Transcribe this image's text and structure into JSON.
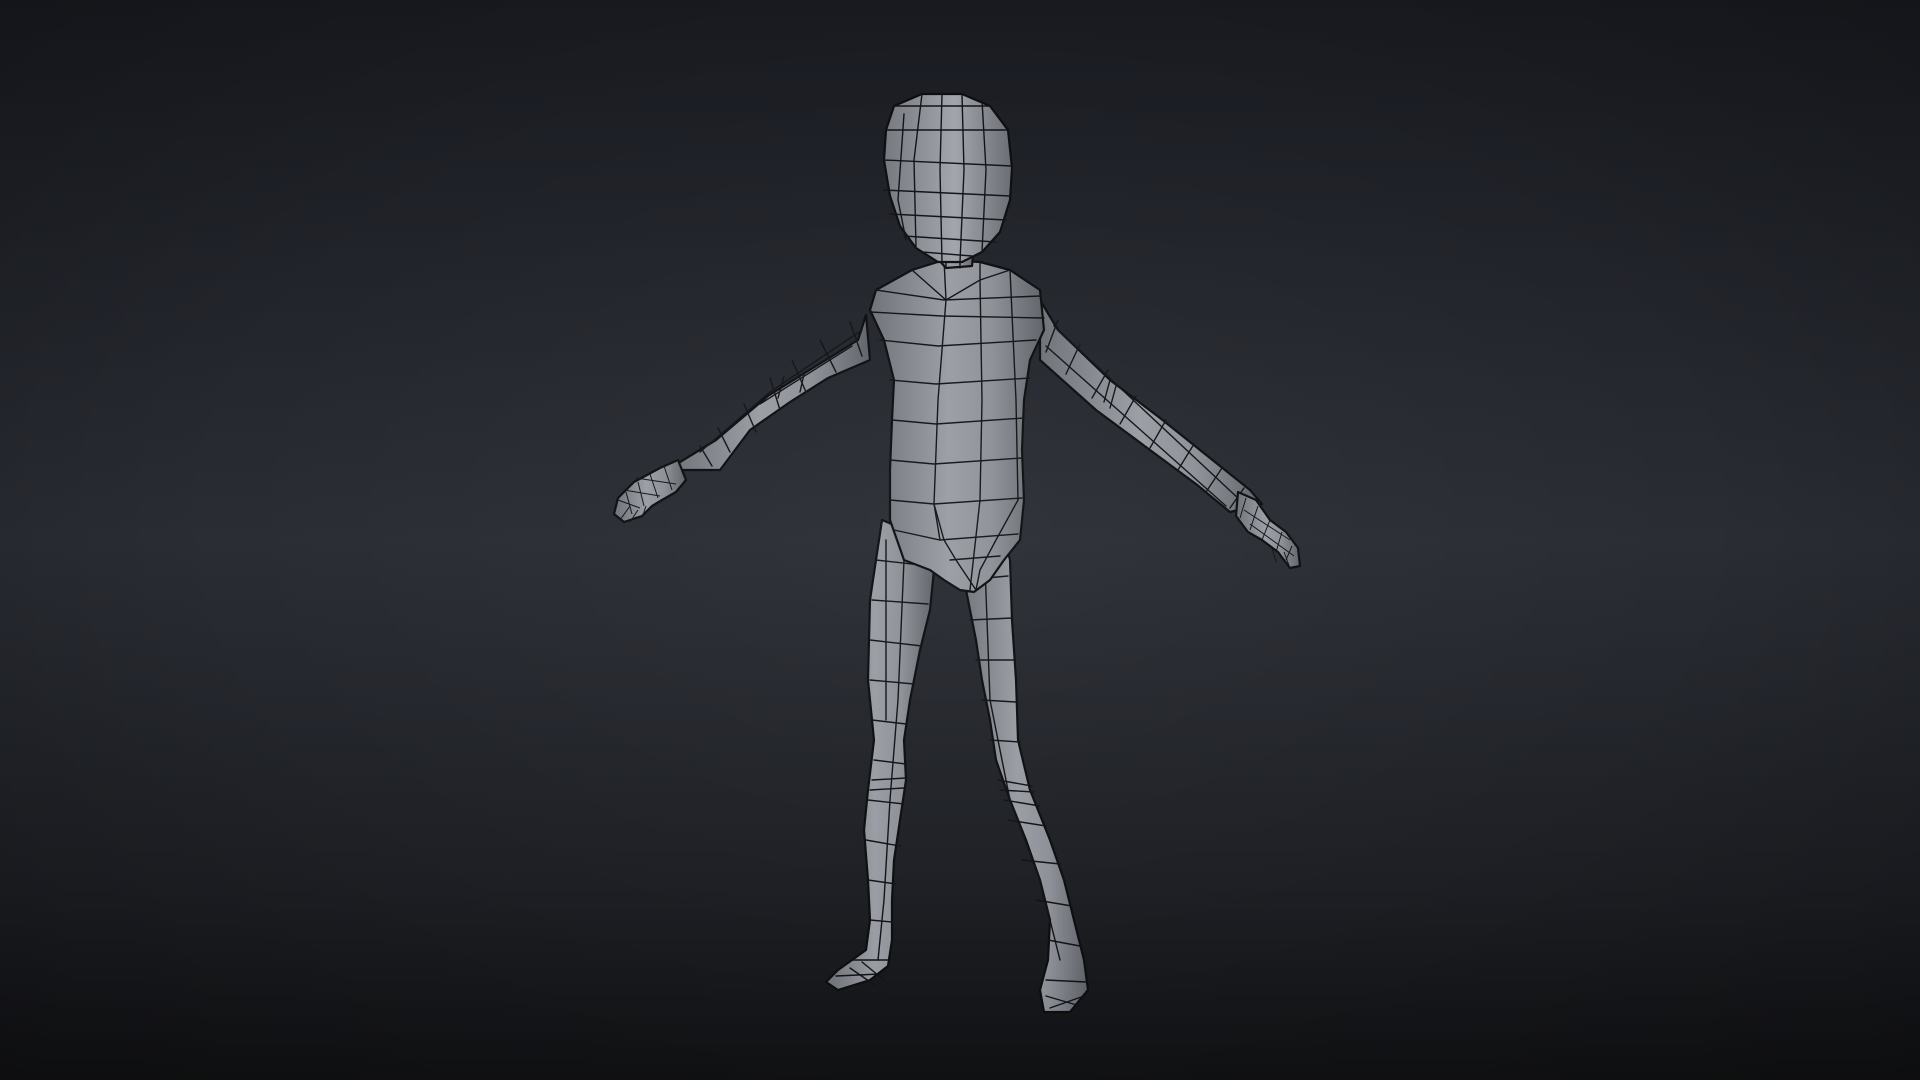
{
  "scene": {
    "background_top": "#191b21",
    "background_mid": "#2a2d34",
    "background_bottom": "#111214",
    "model_base_color": "#8c8f96",
    "wire_color": "#121316",
    "subject": "wireframe-humanoid-t-pose"
  }
}
